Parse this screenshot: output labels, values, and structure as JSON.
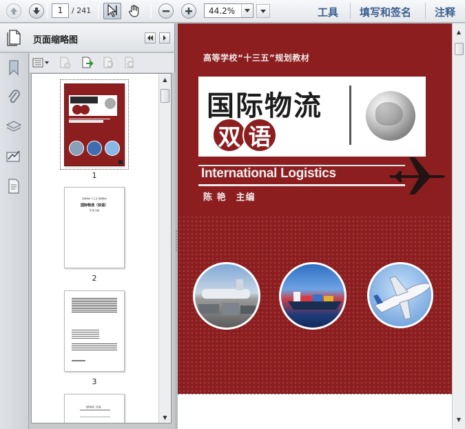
{
  "toolbar": {
    "current_page": "1",
    "page_total": "/ 241",
    "zoom": "44.2%",
    "links": {
      "tools": "工具",
      "fill_sign": "填写和签名",
      "comment": "注释"
    }
  },
  "panel": {
    "title": "页面缩略图",
    "thumbnails": [
      {
        "num": "1",
        "selected": true
      },
      {
        "num": "2"
      },
      {
        "num": "3"
      }
    ]
  },
  "cover": {
    "series": "高等学校“十三五”规划教材",
    "title_main": "国际物流",
    "title_sub_1": "双",
    "title_sub_2": "语",
    "title_en": "International Logistics",
    "author": "陈 艳　主编",
    "background_color": "#8c1e20"
  },
  "thumb_texts": {
    "p2_series": "高等学校“十三五”规划教材",
    "p2_title": "国际物流（双语）",
    "p2_author": "陈 艳 主编",
    "p4_text": "国际物流（双语）"
  },
  "icons": {
    "toolbar": [
      "prev-page-icon",
      "next-page-icon",
      "select-cursor-icon",
      "hand-tool-icon",
      "zoom-out-icon",
      "zoom-in-icon",
      "chevron-down-icon"
    ],
    "rail": [
      "bookmark-icon",
      "attachment-icon",
      "layers-icon",
      "signature-icon",
      "page-content-icon"
    ]
  }
}
